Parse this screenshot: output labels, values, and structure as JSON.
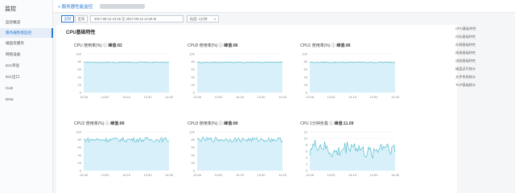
{
  "sidebar": {
    "title": "监控",
    "items": [
      {
        "label": "监控概览",
        "active": false
      },
      {
        "label": "服务器性能监控",
        "active": true
      },
      {
        "label": "磁盘及服务",
        "active": false
      },
      {
        "label": "网络设备",
        "active": false
      },
      {
        "label": "IDC带宽",
        "active": false
      },
      {
        "label": "IDC出口",
        "active": false
      },
      {
        "label": "CLB",
        "active": false
      },
      {
        "label": "DNS",
        "active": false
      }
    ]
  },
  "header": {
    "back_label": "< 服务器性能监控"
  },
  "toolbar": {
    "btn1": "实时",
    "btn2": "近天",
    "date_range": "2017-09-12 13:46  至  2017-09-12 14:46  ⊞",
    "granularity": "粒度: 1分钟",
    "chevron": "▾"
  },
  "section_title": "CPU基础特性",
  "right_nav": [
    "CPU基础特性",
    "内存基础特性",
    "存储基础特性",
    "网络基础特性",
    "进程基础特性",
    "磁盘读写统计",
    "文件系统统计",
    "TCP基础统计"
  ],
  "colors": {
    "accent": "#2a7ad2",
    "area_fill": "#d4eef8",
    "line": "#47b8c8"
  },
  "charts": [
    {
      "label": "CPU 使用率(%)",
      "stat": "峰值:82",
      "kind": "flat",
      "yticks": [
        "100",
        "80",
        "60",
        "40",
        "20",
        "0"
      ],
      "xticks": [
        "13:46",
        "14:00",
        "14:15",
        "14:30",
        "14:45"
      ]
    },
    {
      "label": "CPU0 使用率(%)",
      "stat": "峰值:86",
      "kind": "flat",
      "yticks": [
        "100",
        "80",
        "60",
        "40",
        "20",
        "0"
      ],
      "xticks": [
        "13:46",
        "14:00",
        "14:15",
        "14:30",
        "14:45"
      ]
    },
    {
      "label": "CPU1 使用率(%)",
      "stat": "峰值:86",
      "kind": "flat",
      "yticks": [
        "100",
        "80",
        "60",
        "40",
        "20",
        "0"
      ],
      "xticks": [
        "13:46",
        "14:00",
        "14:15",
        "14:30",
        "14:45"
      ]
    },
    {
      "label": "CPU2 使用率(%)",
      "stat": "峰值:89",
      "kind": "noisy",
      "yticks": [
        "100",
        "80",
        "60",
        "40",
        "20",
        "0"
      ],
      "xticks": [
        "13:46",
        "14:00",
        "14:15",
        "14:30",
        "14:45"
      ]
    },
    {
      "label": "CPU3 使用率(%)",
      "stat": "峰值:89",
      "kind": "noisy",
      "yticks": [
        "100",
        "80",
        "60",
        "40",
        "20",
        "0"
      ],
      "xticks": [
        "13:46",
        "14:00",
        "14:15",
        "14:30",
        "14:45"
      ]
    },
    {
      "label": "CPU 1分钟负载",
      "stat": "峰值:11.09",
      "kind": "load",
      "yticks": [
        "12",
        "10",
        "8",
        "6",
        "4",
        "2",
        "0"
      ],
      "xticks": [
        "13:46",
        "14:00",
        "14:15",
        "14:30",
        "14:45"
      ]
    }
  ]
}
